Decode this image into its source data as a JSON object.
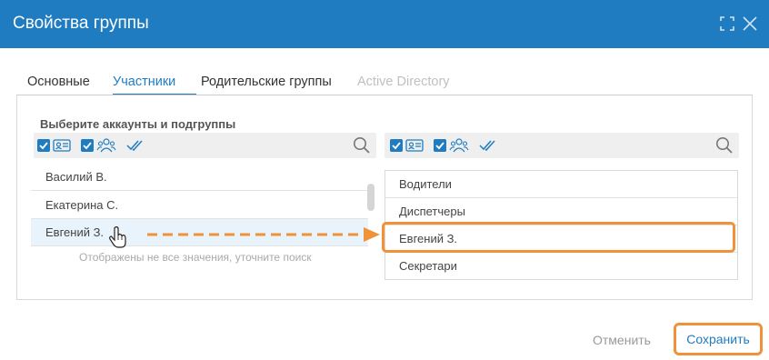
{
  "window": {
    "title": "Свойства группы"
  },
  "tabs": [
    {
      "label": "Основные",
      "state": "normal"
    },
    {
      "label": "Участники",
      "state": "active"
    },
    {
      "label": "Родительские группы",
      "state": "normal"
    },
    {
      "label": "Active Directory",
      "state": "disabled"
    }
  ],
  "members": {
    "select_label": "Выберите аккаунты и подгруппы",
    "left_list": [
      "Василий В.",
      "Екатерина С.",
      "Евгений З."
    ],
    "hint": "Отображены не все значения, уточните поиск",
    "right_list": [
      "Водители",
      "Диспетчеры",
      "Евгений З.",
      "Секретари"
    ]
  },
  "footer": {
    "cancel_label": "Отменить",
    "save_label": "Сохранить"
  },
  "colors": {
    "accent": "#1f7cc1",
    "highlight": "#f0923a"
  },
  "icons": [
    "maximize-icon",
    "close-icon",
    "checkbox-icon",
    "user-card-icon",
    "users-group-icon",
    "double-check-icon",
    "search-icon",
    "hand-cursor-icon"
  ]
}
